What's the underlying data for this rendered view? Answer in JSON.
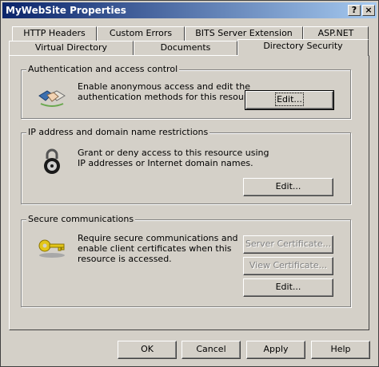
{
  "window": {
    "title": "MyWebSite Properties",
    "help_button": "?",
    "close_button": "×"
  },
  "tabs_back": [
    "HTTP Headers",
    "Custom Errors",
    "BITS Server Extension",
    "ASP.NET"
  ],
  "tabs_front": [
    "Virtual Directory",
    "Documents",
    "Directory Security"
  ],
  "active_tab": "Directory Security",
  "auth": {
    "legend": "Authentication and access control",
    "line1": "Enable anonymous access and edit the",
    "line2": "authentication methods for this resource.",
    "edit": "Edit..."
  },
  "ip": {
    "legend": "IP address and domain name restrictions",
    "line1": "Grant or deny access to this resource using",
    "line2": "IP addresses or Internet domain names.",
    "edit": "Edit..."
  },
  "secure": {
    "legend": "Secure communications",
    "line1": "Require secure communications and",
    "line2": "enable client certificates when this",
    "line3": "resource is accessed.",
    "server_cert": "Server Certificate...",
    "view_cert": "View Certificate...",
    "edit": "Edit..."
  },
  "footer": {
    "ok": "OK",
    "cancel": "Cancel",
    "apply": "Apply",
    "help": "Help"
  },
  "icons": {
    "auth": "handshake-icon",
    "ip": "padlock-icon",
    "secure": "key-icon"
  }
}
